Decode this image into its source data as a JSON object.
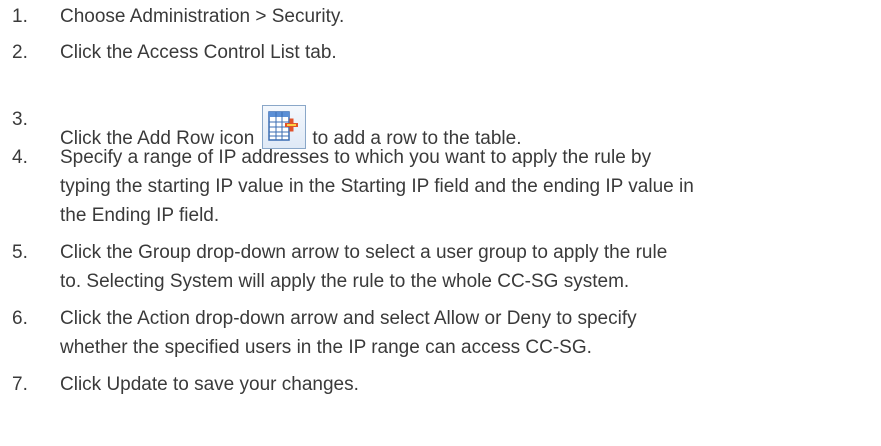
{
  "steps": [
    {
      "num": "1.",
      "text": "Choose Administration > Security."
    },
    {
      "num": "2.",
      "text": "Click the Access Control List tab."
    },
    {
      "num": "3.",
      "text_before": "Click the Add Row icon",
      "icon": "add-row-icon",
      "text_after": "to add a row to the table."
    },
    {
      "num": "4.",
      "lines": [
        "Specify a range of IP addresses to which you want to apply the rule by",
        "typing the starting IP value in the Starting IP field and the ending IP value in",
        "the Ending IP field."
      ]
    },
    {
      "num": "5.",
      "lines": [
        "Click the Group drop-down arrow to select a user group to apply the rule",
        "to. Selecting System will apply the rule to the whole CC-SG system."
      ]
    },
    {
      "num": "6.",
      "lines": [
        "Click the Action drop-down arrow and select Allow or Deny to specify",
        "whether the specified users in the IP range can access CC-SG."
      ]
    },
    {
      "num": "7.",
      "text": "Click Update to save your changes."
    }
  ]
}
